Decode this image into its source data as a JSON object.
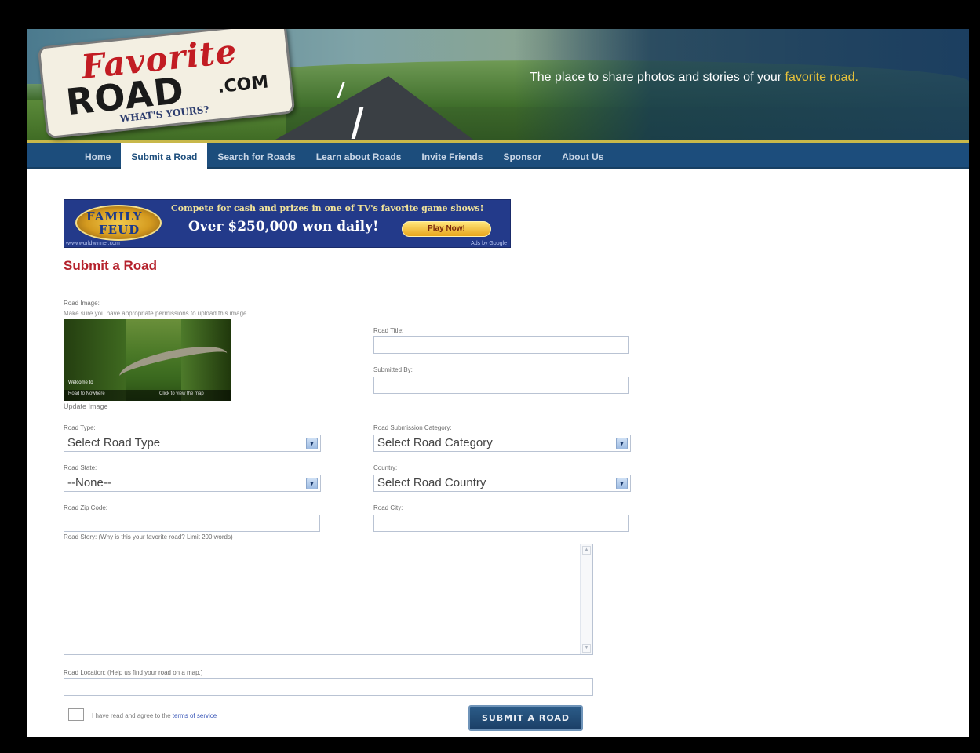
{
  "header": {
    "logo_favorite": "Favorite",
    "logo_road": "ROAD",
    "logo_com": ".COM",
    "logo_tagline": "WHAT'S YOURS?",
    "tagline_main": "The place to share photos and stories of your ",
    "tagline_highlight": "favorite road."
  },
  "nav": {
    "items": [
      {
        "label": "Home"
      },
      {
        "label": "Submit a Road"
      },
      {
        "label": "Search for Roads"
      },
      {
        "label": "Learn about Roads"
      },
      {
        "label": "Invite Friends"
      },
      {
        "label": "Sponsor"
      },
      {
        "label": "About Us"
      }
    ],
    "active": "Submit a Road"
  },
  "ad": {
    "logo_line1": "FAMILY",
    "logo_line2": "FEUD",
    "line1": "Compete for cash and prizes in one of TV's favorite game shows!",
    "line2": "Over $250,000 won daily!",
    "button": "Play Now!",
    "url": "www.worldwinner.com",
    "ads_by": "Ads by Google"
  },
  "form": {
    "title": "Submit a Road",
    "road_image_label": "Road Image:",
    "image_note": "Make sure you have appropriate permissions to upload this image.",
    "image_caption1": "Welcome to",
    "image_caption2": "Road to Nowhere",
    "image_caption3": "Click to view the map",
    "update_image": "Update Image",
    "road_title_label": "Road Title:",
    "road_title_value": "",
    "submitted_by_label": "Submitted By:",
    "submitted_by_value": "",
    "road_type_label": "Road Type:",
    "road_type_value": "Select Road Type",
    "category_label": "Road Submission Category:",
    "category_value": "Select Road Category",
    "state_label": "Road State:",
    "state_value": "--None--",
    "country_label": "Country:",
    "country_value": "Select Road Country",
    "zip_label": "Road Zip Code:",
    "zip_value": "",
    "city_label": "Road City:",
    "city_value": "",
    "story_label": "Road Story: (Why is this your favorite road? Limit 200 words)",
    "story_value": "",
    "location_label": "Road Location: (Help us find your road on a map.)",
    "location_value": "",
    "tos_text": "I have read and agree to the ",
    "tos_link": "terms of service",
    "submit_label": "SUBMIT A ROAD"
  },
  "colors": {
    "nav_bg": "#1c4d7c",
    "title_red": "#b5222d",
    "tagline_highlight": "#e8c23a",
    "submit_bg": "#1b3f66"
  },
  "icons": {
    "select_arrow": "chevron-down-icon",
    "scroll_up": "scroll-up-icon",
    "scroll_down": "scroll-down-icon"
  }
}
